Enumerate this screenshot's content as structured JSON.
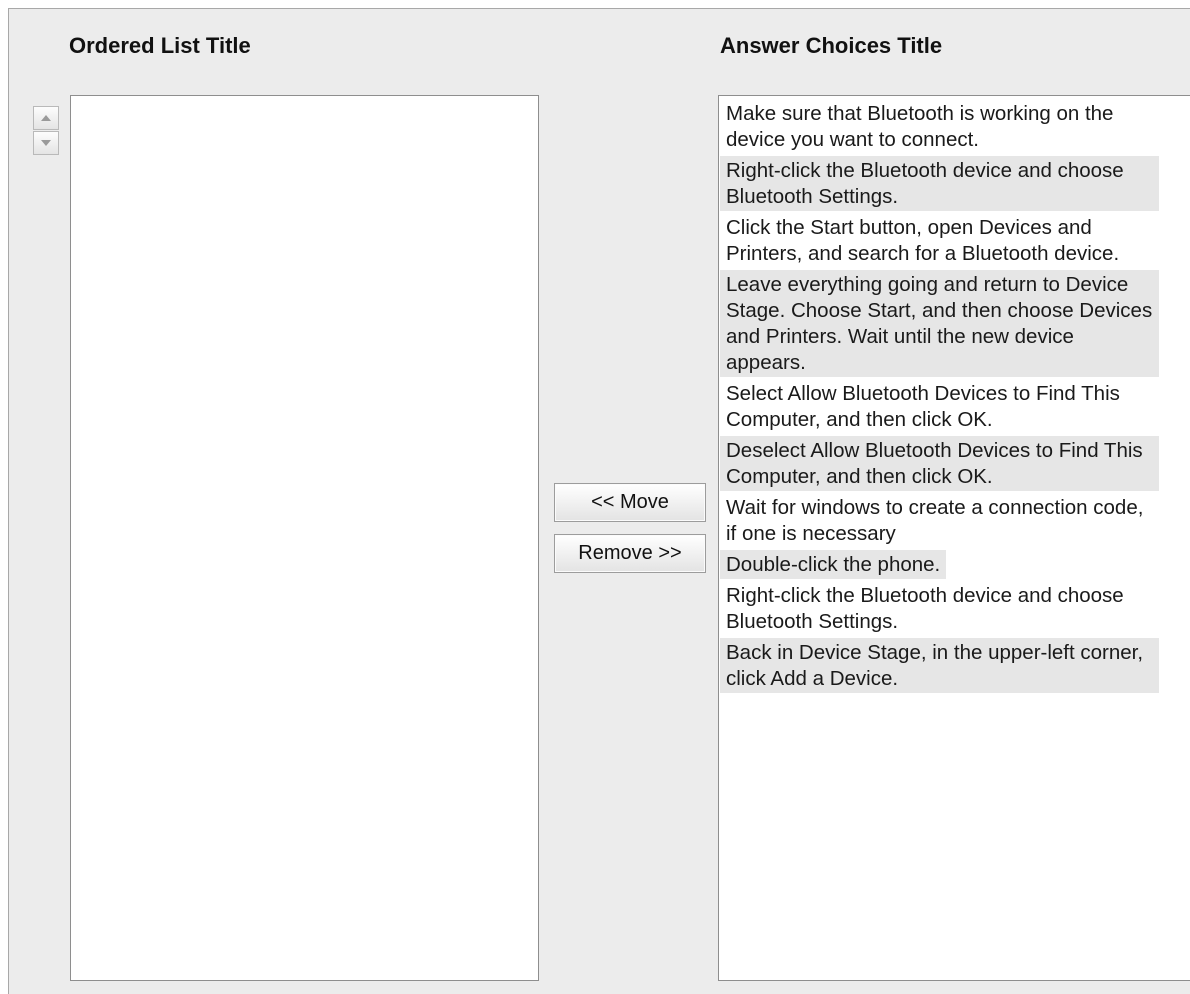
{
  "ordered_list": {
    "title": "Ordered List Title",
    "items": []
  },
  "answer_choices": {
    "title": "Answer Choices Title",
    "items": [
      "Make sure that Bluetooth is working on the device you want to connect.",
      "Right-click the Bluetooth device and choose Bluetooth Settings.",
      "Click the Start button, open Devices and Printers, and search for a Bluetooth device.",
      "Leave everything going and return to Device Stage. Choose Start, and then choose Devices and Printers. Wait until the new device appears.",
      "Select Allow Bluetooth Devices to Find This Computer, and then click OK.",
      "Deselect Allow Bluetooth Devices to Find This Computer, and then click OK.",
      "Wait for windows to create a connection code, if one is necessary",
      "Double-click the phone.",
      "Right-click the Bluetooth device and choose Bluetooth Settings.",
      "Back in Device Stage, in the upper-left corner, click Add a Device."
    ]
  },
  "buttons": {
    "move_label": "<< Move",
    "remove_label": "Remove >>"
  },
  "icons": {
    "move_up": "arrow-up-icon",
    "move_down": "arrow-down-icon"
  },
  "colors": {
    "panel_background": "#ececec",
    "list_background": "#ffffff",
    "alternate_row": "#e6e6e6"
  }
}
